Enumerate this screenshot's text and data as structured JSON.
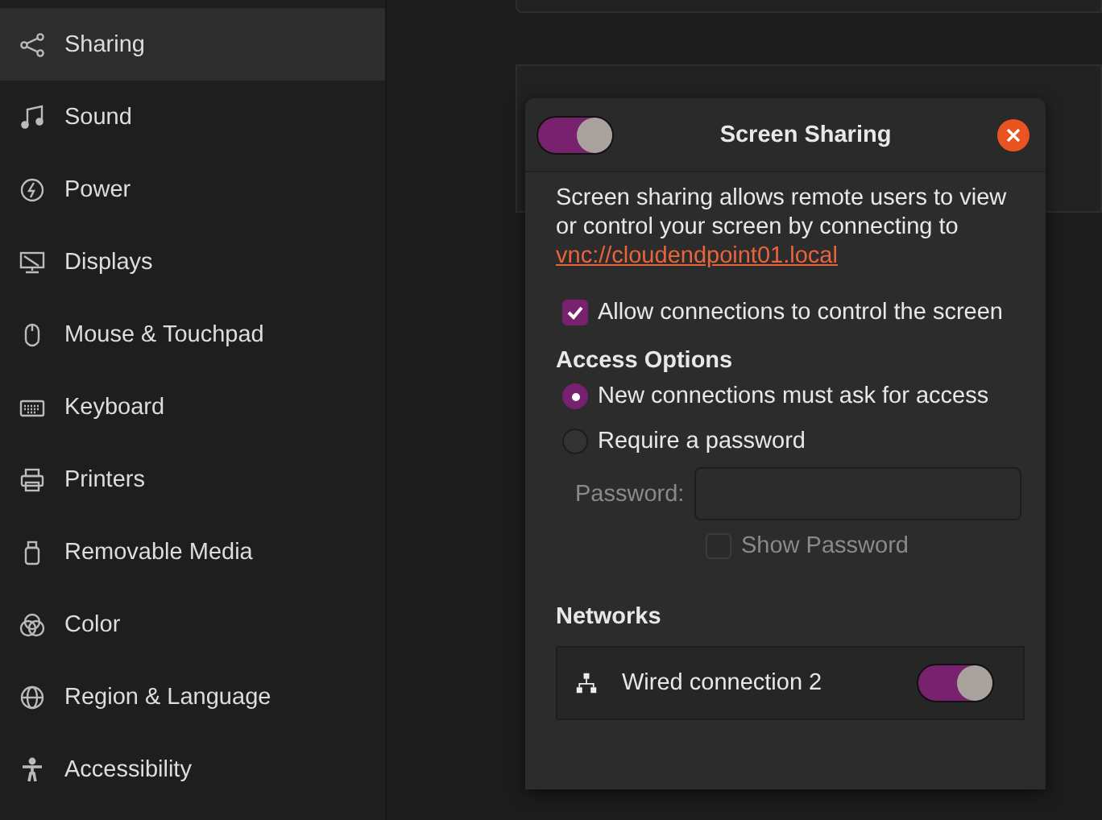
{
  "sidebar": {
    "items": [
      {
        "label": "Sharing",
        "selected": true
      },
      {
        "label": "Sound",
        "selected": false
      },
      {
        "label": "Power",
        "selected": false
      },
      {
        "label": "Displays",
        "selected": false
      },
      {
        "label": "Mouse & Touchpad",
        "selected": false
      },
      {
        "label": "Keyboard",
        "selected": false
      },
      {
        "label": "Printers",
        "selected": false
      },
      {
        "label": "Removable Media",
        "selected": false
      },
      {
        "label": "Color",
        "selected": false
      },
      {
        "label": "Region & Language",
        "selected": false
      },
      {
        "label": "Accessibility",
        "selected": false
      }
    ]
  },
  "dialog": {
    "title": "Screen Sharing",
    "enabled": true,
    "description": "Screen sharing allows remote users to view or control your screen by connecting to",
    "link": "vnc://cloudendpoint01.local",
    "allow_control": {
      "label": "Allow connections to control the screen",
      "checked": true
    },
    "access_options": {
      "heading": "Access Options",
      "options": [
        {
          "label": "New connections must ask for access",
          "selected": true
        },
        {
          "label": "Require a password",
          "selected": false
        }
      ]
    },
    "password": {
      "label": "Password:",
      "disabled": true
    },
    "show_password": {
      "label": "Show Password",
      "checked": false,
      "disabled": true
    },
    "networks": {
      "heading": "Networks",
      "items": [
        {
          "name": "Wired connection 2",
          "on": true
        }
      ]
    }
  }
}
